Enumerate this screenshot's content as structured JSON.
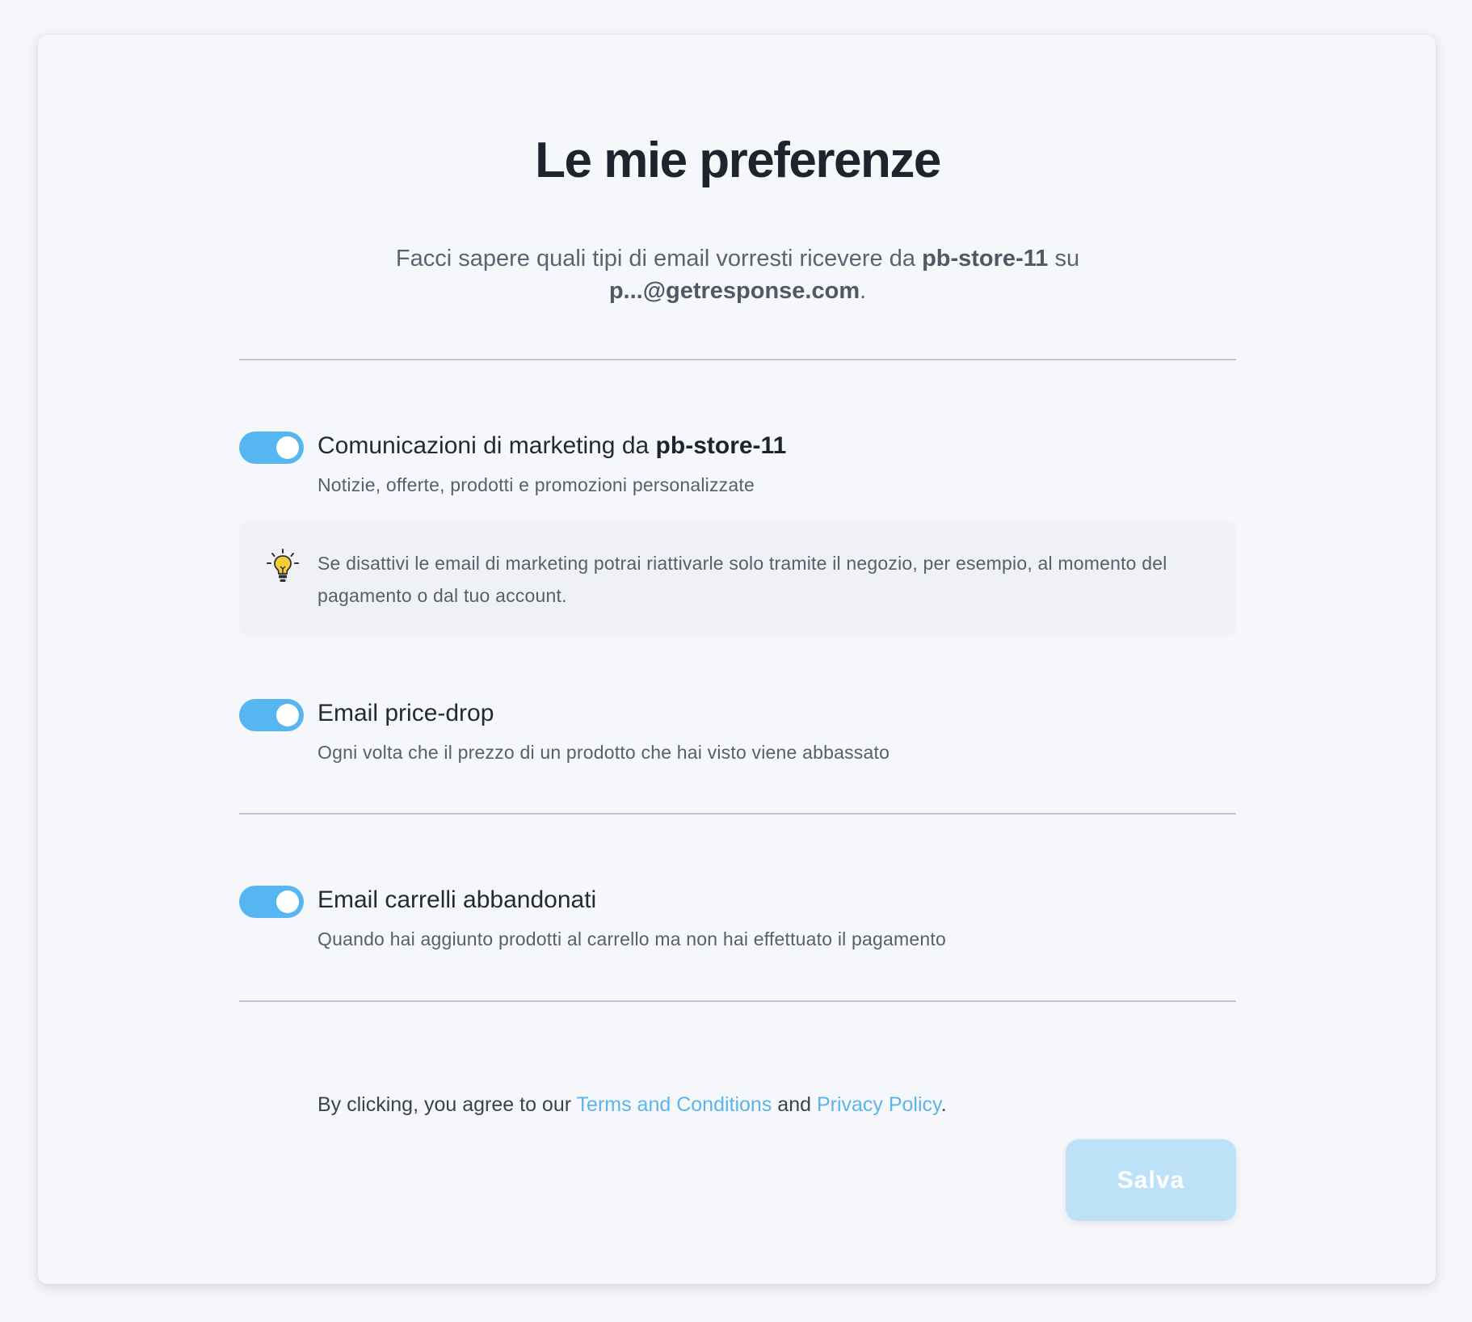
{
  "page": {
    "title": "Le mie preferenze",
    "subtitle": {
      "before": "Facci sapere quali tipi di email vorresti ricevere da ",
      "store": "pb-store-11",
      "middle": " su ",
      "email": "p...@getresponse.com",
      "after": "."
    }
  },
  "preferences": [
    {
      "title": "Comunicazioni di marketing da ",
      "title_bold": "pb-store-11",
      "description": "Notizie, offerte, prodotti e promozioni personalizzate",
      "enabled": true
    },
    {
      "title": "Email price-drop",
      "description": "Ogni volta che il prezzo di un prodotto che hai visto viene abbassato",
      "enabled": true
    },
    {
      "title": "Email carrelli abbandonati",
      "description": "Quando hai aggiunto prodotti al carrello ma non hai effettuato il pagamento",
      "enabled": true
    }
  ],
  "tip": {
    "icon": "lightbulb-icon",
    "text": "Se disattivi le email di marketing potrai riattivarle solo tramite il negozio, per esempio, al momento del pagamento o dal tuo account."
  },
  "legal": {
    "before": "By clicking, you agree to our ",
    "terms_link": "Terms and Conditions",
    "middle": " and ",
    "privacy_link": "Privacy Policy",
    "after": "."
  },
  "actions": {
    "save_label": "Salva"
  },
  "colors": {
    "accent": "#56b6f2",
    "link": "#5ab5ea",
    "save_button_disabled": "#bde2f7",
    "background": "#f6f7fa"
  }
}
